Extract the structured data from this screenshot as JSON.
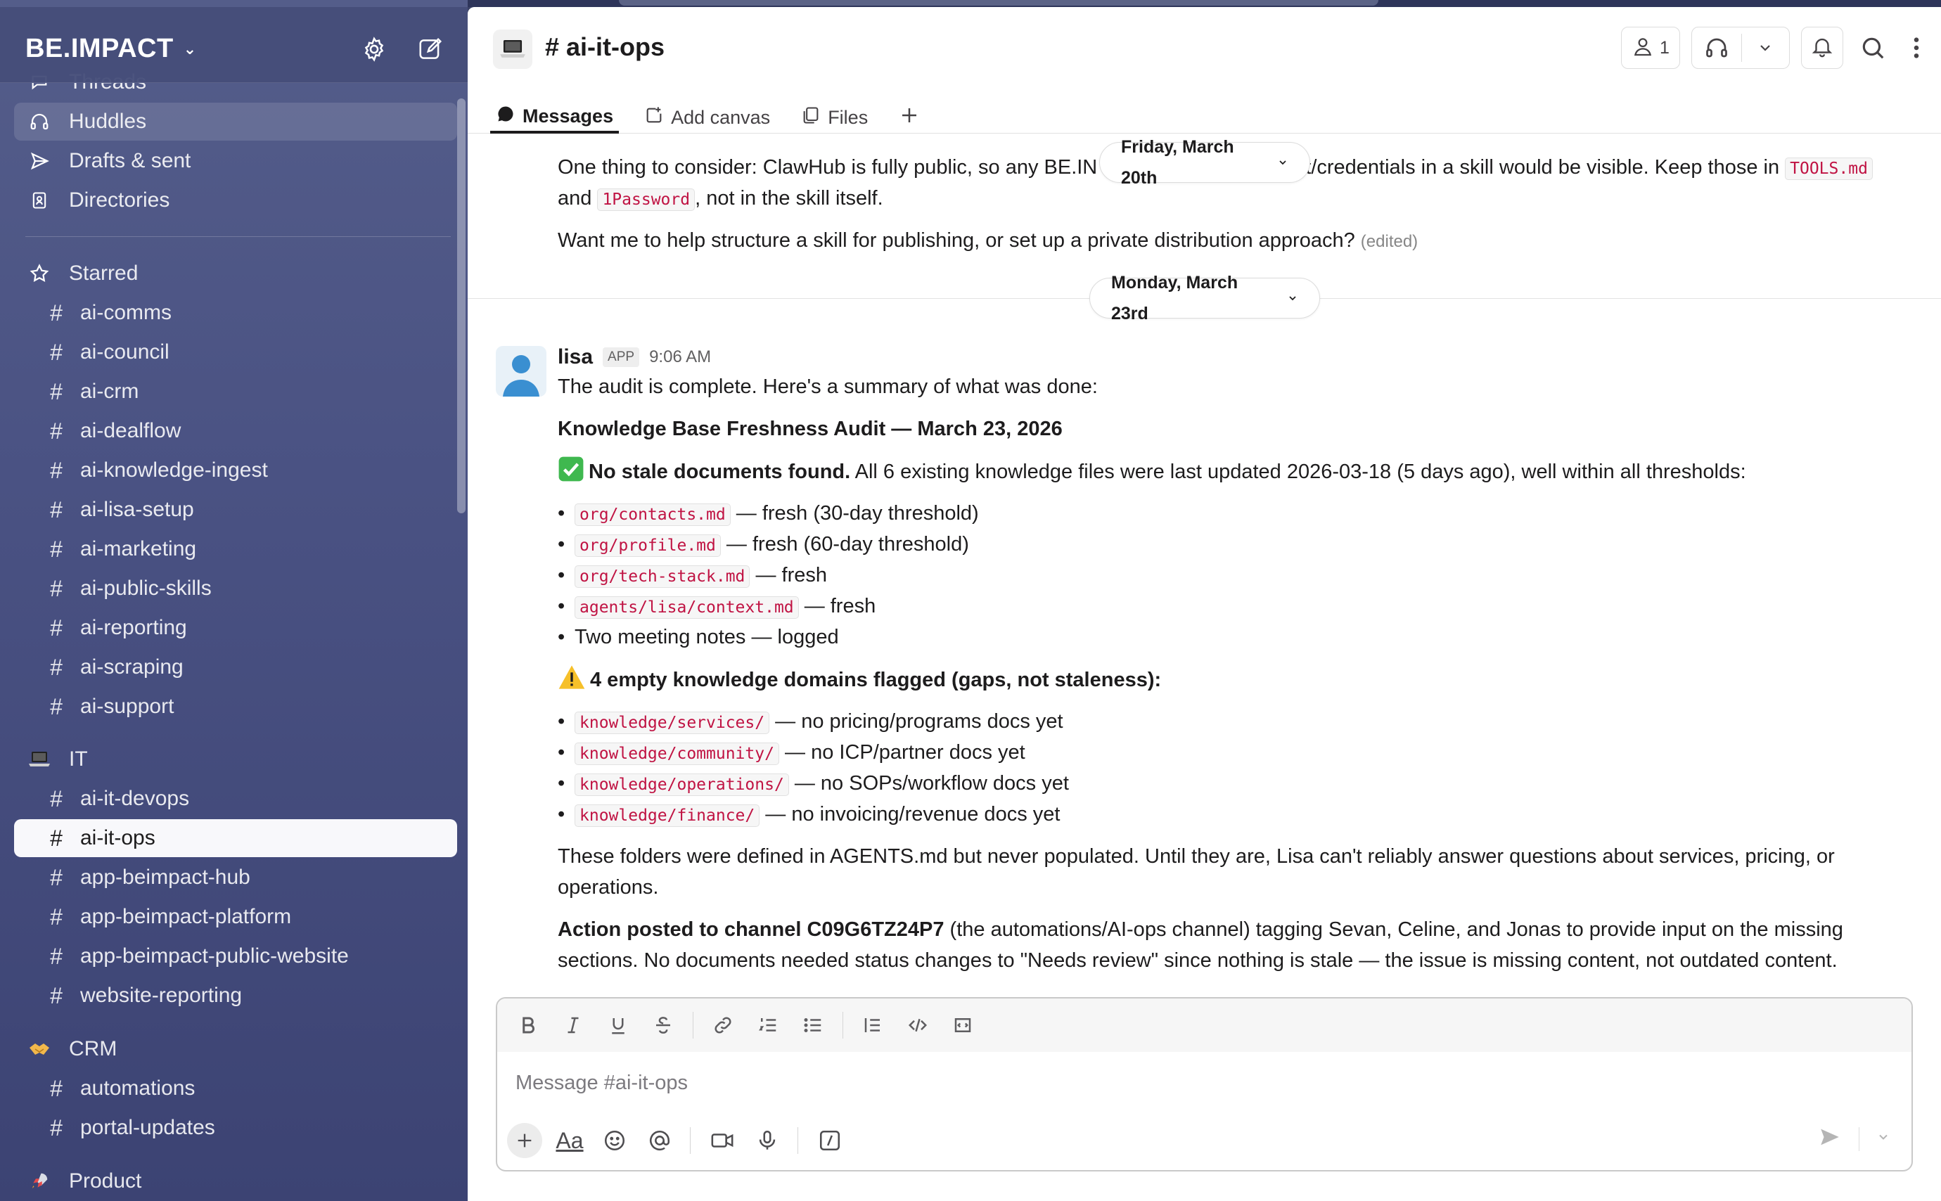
{
  "workspace": {
    "name": "BE.IMPACT"
  },
  "sidebar": {
    "nav": [
      {
        "label": "Threads",
        "icon": "threads-icon"
      },
      {
        "label": "Huddles",
        "icon": "headphones-icon"
      },
      {
        "label": "Drafts & sent",
        "icon": "send-icon"
      },
      {
        "label": "Directories",
        "icon": "directory-icon"
      }
    ],
    "starred_label": "Starred",
    "starred": [
      "ai-comms",
      "ai-council",
      "ai-crm",
      "ai-dealflow",
      "ai-knowledge-ingest",
      "ai-lisa-setup",
      "ai-marketing",
      "ai-public-skills",
      "ai-reporting",
      "ai-scraping",
      "ai-support"
    ],
    "it_label": "IT",
    "it": [
      "ai-it-devops",
      "ai-it-ops",
      "app-beimpact-hub",
      "app-beimpact-platform",
      "app-beimpact-public-website",
      "website-reporting"
    ],
    "crm_label": "CRM",
    "crm": [
      "automations",
      "portal-updates"
    ],
    "product_label": "Product"
  },
  "channel": {
    "title": "# ai-it-ops",
    "member_count": "1",
    "tabs": [
      "Messages",
      "Add canvas",
      "Files"
    ]
  },
  "messages": {
    "prev_line1_a": "One thing to consider: ClawHub is fully public, so any BE.IN",
    "prev_line1_b": "t/credentials in a skill would be visible. Keep those in",
    "prev_code_tools": "TOOLS.md",
    "prev_line2_a": "and",
    "prev_code_1pw": "1Password",
    "prev_line2_b": ", not in the skill itself.",
    "prev_line3": "Want me to help structure a skill for publishing, or set up a private distribution approach?",
    "prev_edited": "(edited)",
    "date_top": "Friday, March 20th",
    "date_sep": "Monday, March 23rd",
    "author": "lisa",
    "badge": "APP",
    "time": "9:06 AM",
    "intro": "The audit is complete. Here's a summary of what was done:",
    "heading": "Knowledge Base Freshness Audit — March 23, 2026",
    "no_stale_bold": "No stale documents found.",
    "no_stale_rest": " All 6 existing knowledge files were last updated 2026-03-18 (5 days ago), well within all thresholds:",
    "fresh_items": [
      {
        "code": "org/contacts.md",
        "text": " — fresh (30-day threshold)"
      },
      {
        "code": "org/profile.md",
        "text": " — fresh (60-day threshold)"
      },
      {
        "code": "org/tech-stack.md",
        "text": " — fresh"
      },
      {
        "code": "agents/lisa/context.md",
        "text": " — fresh"
      }
    ],
    "meeting_notes": "Two meeting notes — logged",
    "empty_heading": "4 empty knowledge domains flagged (gaps, not staleness):",
    "empty_items": [
      {
        "code": "knowledge/services/",
        "text": " — no pricing/programs docs yet"
      },
      {
        "code": "knowledge/community/",
        "text": " — no ICP/partner docs yet"
      },
      {
        "code": "knowledge/operations/",
        "text": " — no SOPs/workflow docs yet"
      },
      {
        "code": "knowledge/finance/",
        "text": " — no invoicing/revenue docs yet"
      }
    ],
    "folders_line1": "These folders were defined in AGENTS.md but never populated. Until they are, Lisa can't reliably answer questions about services, pricing, or",
    "folders_line2": "operations.",
    "action_bold": "Action posted to channel C09G6TZ24P7",
    "action_rest1": " (the automations/AI-ops channel) tagging Sevan, Celine, and Jonas to provide input on the missing",
    "action_line2": "sections. No documents needed status changes to \"Needs review\" since nothing is stale — the issue is missing content, not outdated content."
  },
  "composer": {
    "placeholder": "Message #ai-it-ops",
    "aa_label": "Aa"
  },
  "colors": {
    "accent": "#1264a3",
    "code": "#c01343",
    "sidebar": "#4a5283"
  }
}
